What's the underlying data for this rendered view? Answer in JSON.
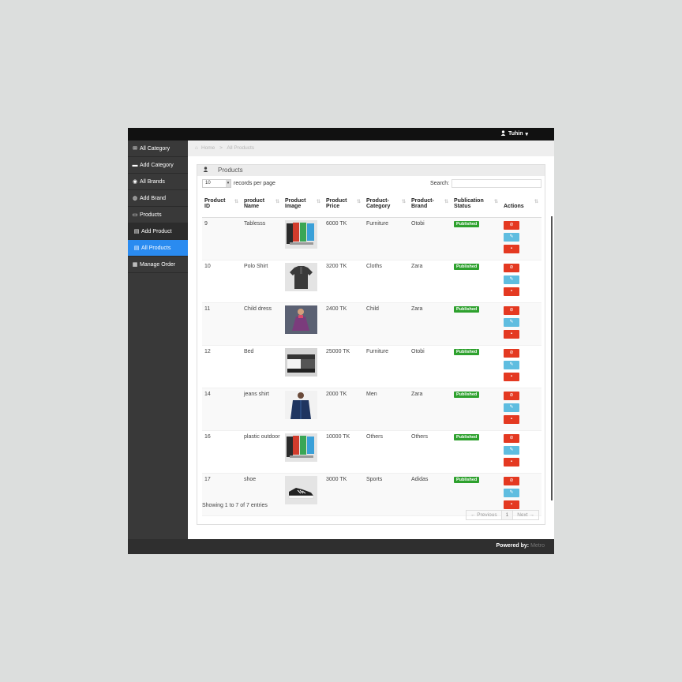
{
  "header": {
    "user_name": "Tuhin",
    "caret": "▾"
  },
  "sidebar": {
    "items": [
      {
        "label": "All Category",
        "icon": "envelope-icon",
        "glyph": "✉"
      },
      {
        "label": "Add Category",
        "icon": "card-icon",
        "glyph": "▬"
      },
      {
        "label": "All Brands",
        "icon": "eye-icon",
        "glyph": "◉"
      },
      {
        "label": "Add Brand",
        "icon": "dashboard-icon",
        "glyph": "◍"
      },
      {
        "label": "Products",
        "icon": "folder-icon",
        "glyph": "▭"
      },
      {
        "label": "Add Product",
        "icon": "file-icon",
        "glyph": "▤"
      },
      {
        "label": "All Products",
        "icon": "file-icon",
        "glyph": "▤"
      },
      {
        "label": "Manage Order",
        "icon": "list-icon",
        "glyph": "▦"
      }
    ],
    "active_index": 6
  },
  "breadcrumb": {
    "home": "Home",
    "separator": ">",
    "current": "All Products"
  },
  "panel": {
    "title": "Products"
  },
  "table_controls": {
    "length_value": "10",
    "length_label": "records per page",
    "search_label": "Search:",
    "search_value": ""
  },
  "table": {
    "columns": [
      {
        "l1": "Product",
        "l2": "ID",
        "sort": "⇅"
      },
      {
        "l1": "product",
        "l2": "Name",
        "sort": "⇅"
      },
      {
        "l1": "Product",
        "l2": "Image",
        "sort": "⇅"
      },
      {
        "l1": "Product",
        "l2": "Price",
        "sort": "⇅"
      },
      {
        "l1": "Product-",
        "l2": "Category",
        "sort": "⇅"
      },
      {
        "l1": "Product-",
        "l2": "Brand",
        "sort": "⇅"
      },
      {
        "l1": "Publication",
        "l2": "Status",
        "sort": "⇅"
      },
      {
        "l1": "",
        "l2": "Actions",
        "sort": "⇅"
      }
    ],
    "rows": [
      {
        "id": "9",
        "name": "Tablesss",
        "image": "chairs-image",
        "price": "6000 TK",
        "category": "Furniture",
        "brand": "Otobi",
        "status": "Published"
      },
      {
        "id": "10",
        "name": "Polo Shirt",
        "image": "polo-shirt-image",
        "price": "3200 TK",
        "category": "Cloths",
        "brand": "Zara",
        "status": "Published"
      },
      {
        "id": "11",
        "name": "Child dress",
        "image": "child-dress-image",
        "price": "2400 TK",
        "category": "Child",
        "brand": "Zara",
        "status": "Published"
      },
      {
        "id": "12",
        "name": "Bed",
        "image": "bed-image",
        "price": "25000 TK",
        "category": "Furniture",
        "brand": "Otobi",
        "status": "Published"
      },
      {
        "id": "14",
        "name": "jeans shirt",
        "image": "jeans-shirt-image",
        "price": "2000 TK",
        "category": "Men",
        "brand": "Zara",
        "status": "Published"
      },
      {
        "id": "16",
        "name": "plastic outdoor",
        "image": "chairs-image",
        "price": "10000 TK",
        "category": "Others",
        "brand": "Others",
        "status": "Published"
      },
      {
        "id": "17",
        "name": "shoe",
        "image": "shoe-image",
        "price": "3000 TK",
        "category": "Sports",
        "brand": "Adidas",
        "status": "Published"
      }
    ]
  },
  "table_info": "Showing 1 to 7 of 7 entries",
  "pagination": {
    "previous": "← Previous",
    "page": "1",
    "next": "Next →"
  },
  "footer": {
    "powered_label": "Powered by:",
    "brand": "Metro"
  },
  "colors": {
    "accent": "#2a8bf0",
    "published": "#2ea12e",
    "danger": "#e43921",
    "info": "#5fbde0"
  }
}
